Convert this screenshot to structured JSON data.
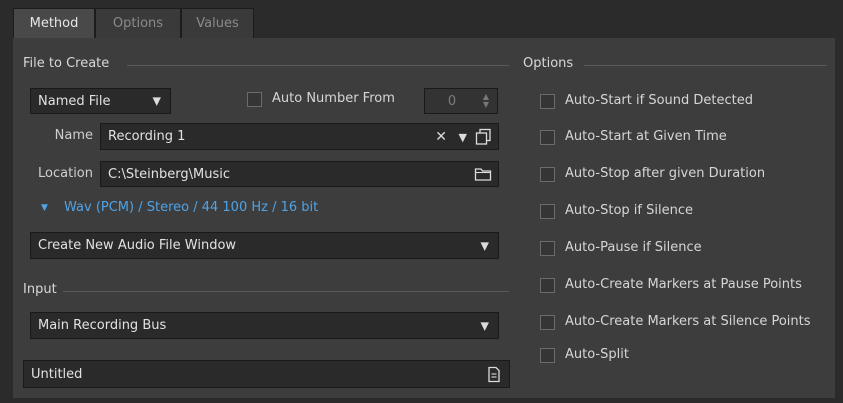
{
  "tabs": [
    {
      "label": "Method",
      "active": true
    },
    {
      "label": "Options",
      "active": false
    },
    {
      "label": "Values",
      "active": false
    }
  ],
  "file_to_create": {
    "section_label": "File to Create",
    "mode_select": "Named File",
    "auto_number_label": "Auto Number From",
    "auto_number_value": "0",
    "name_label": "Name",
    "name_value": "Recording 1",
    "location_label": "Location",
    "location_value": "C:\\Steinberg\\Music",
    "format_text": "Wav (PCM) / Stereo / 44 100 Hz / 16 bit",
    "window_select": "Create New Audio File Window"
  },
  "input": {
    "section_label": "Input",
    "bus_select": "Main Recording Bus",
    "title_value": "Untitled"
  },
  "options": {
    "section_label": "Options",
    "items": [
      {
        "label": "Auto-Start if Sound Detected",
        "checked": false
      },
      {
        "label": "Auto-Start at Given Time",
        "checked": false
      },
      {
        "label": "Auto-Stop after given Duration",
        "checked": false
      },
      {
        "label": "Auto-Stop if Silence",
        "checked": false
      },
      {
        "label": "Auto-Pause if Silence",
        "checked": false
      },
      {
        "label": "Auto-Create Markers at Pause Points",
        "checked": false
      },
      {
        "label": "Auto-Create Markers at Silence Points",
        "checked": false
      },
      {
        "label": "Auto-Split",
        "checked": false
      }
    ]
  },
  "icons": {
    "clear": "close-icon",
    "dropdown": "chevron-down-icon",
    "copy": "copy-icon",
    "folder": "folder-icon",
    "title_picker": "document-icon",
    "spinner": "spinner-icon"
  },
  "colors": {
    "background": "#2b2b2b",
    "panel": "#3d3d3d",
    "field": "#2a2a2a",
    "link": "#4fa3e6"
  }
}
